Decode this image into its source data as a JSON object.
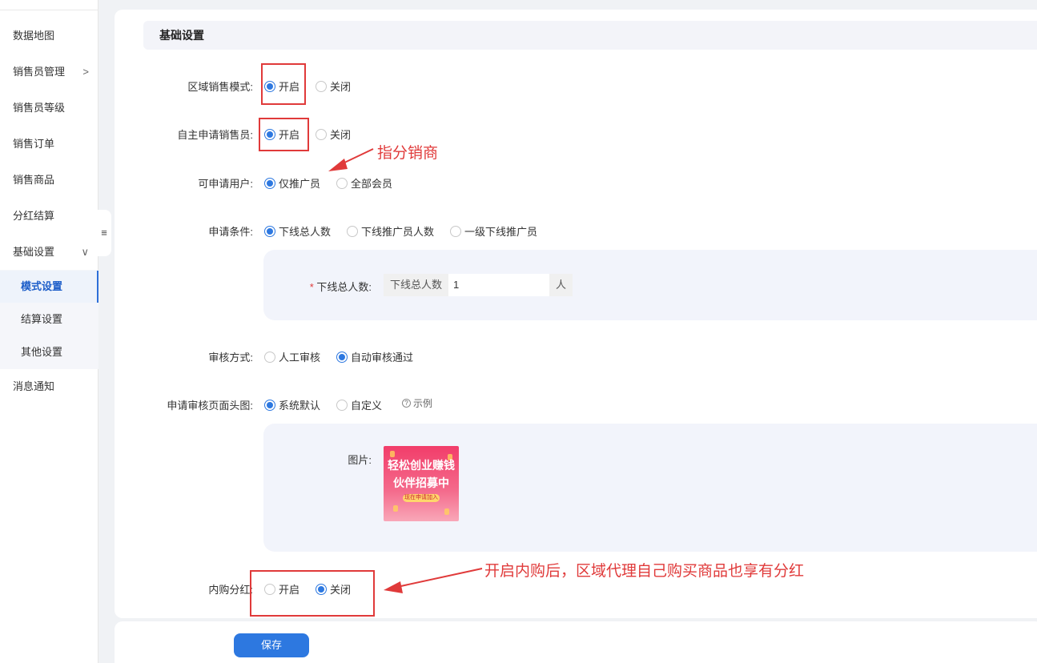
{
  "sidebar": {
    "items": [
      {
        "label": "数据地图"
      },
      {
        "label": "销售员管理",
        "arrow": ">"
      },
      {
        "label": "销售员等级"
      },
      {
        "label": "销售订单"
      },
      {
        "label": "销售商品"
      },
      {
        "label": "分红结算"
      },
      {
        "label": "基础设置",
        "arrow": "∨"
      },
      {
        "label": "消息通知"
      }
    ],
    "subitems": [
      {
        "label": "模式设置",
        "active": true
      },
      {
        "label": "结算设置"
      },
      {
        "label": "其他设置"
      }
    ],
    "collapse_icon": "≡"
  },
  "section": {
    "title": "基础设置"
  },
  "form": {
    "regional_mode": {
      "label": "区域销售模式:",
      "options": [
        "开启",
        "关闭"
      ],
      "selected": "开启"
    },
    "self_apply": {
      "label": "自主申请销售员:",
      "options": [
        "开启",
        "关闭"
      ],
      "selected": "开启"
    },
    "eligible_users": {
      "label": "可申请用户:",
      "options": [
        "仅推广员",
        "全部会员"
      ],
      "selected": "仅推广员"
    },
    "apply_condition": {
      "label": "申请条件:",
      "options": [
        "下线总人数",
        "下线推广员人数",
        "一级下线推广员"
      ],
      "selected": "下线总人数"
    },
    "downline_total": {
      "label": "下线总人数:",
      "required_mark": "*",
      "prefix": "下线总人数",
      "value": "1",
      "suffix": "人"
    },
    "review_mode": {
      "label": "审核方式:",
      "options": [
        "人工审核",
        "自动审核通过"
      ],
      "selected": "自动审核通过"
    },
    "header_image": {
      "label": "申请审核页面头图:",
      "options": [
        "系统默认",
        "自定义"
      ],
      "selected": "系统默认",
      "example_label": "示例"
    },
    "image": {
      "label": "图片:",
      "promo_line1": "轻松创业赚钱",
      "promo_line2": "伙伴招募中",
      "promo_button": "现在申请加入"
    },
    "internal_dividend": {
      "label": "内购分红:",
      "options": [
        "开启",
        "关闭"
      ],
      "selected": "关闭"
    }
  },
  "save_label": "保存",
  "annotations": {
    "note1": "指分销商",
    "note2": "开启内购后，区域代理自己购买商品也享有分红",
    "color": "#e03a3a"
  },
  "colors": {
    "accent": "#2d78e0",
    "panel": "#f2f4fb"
  }
}
